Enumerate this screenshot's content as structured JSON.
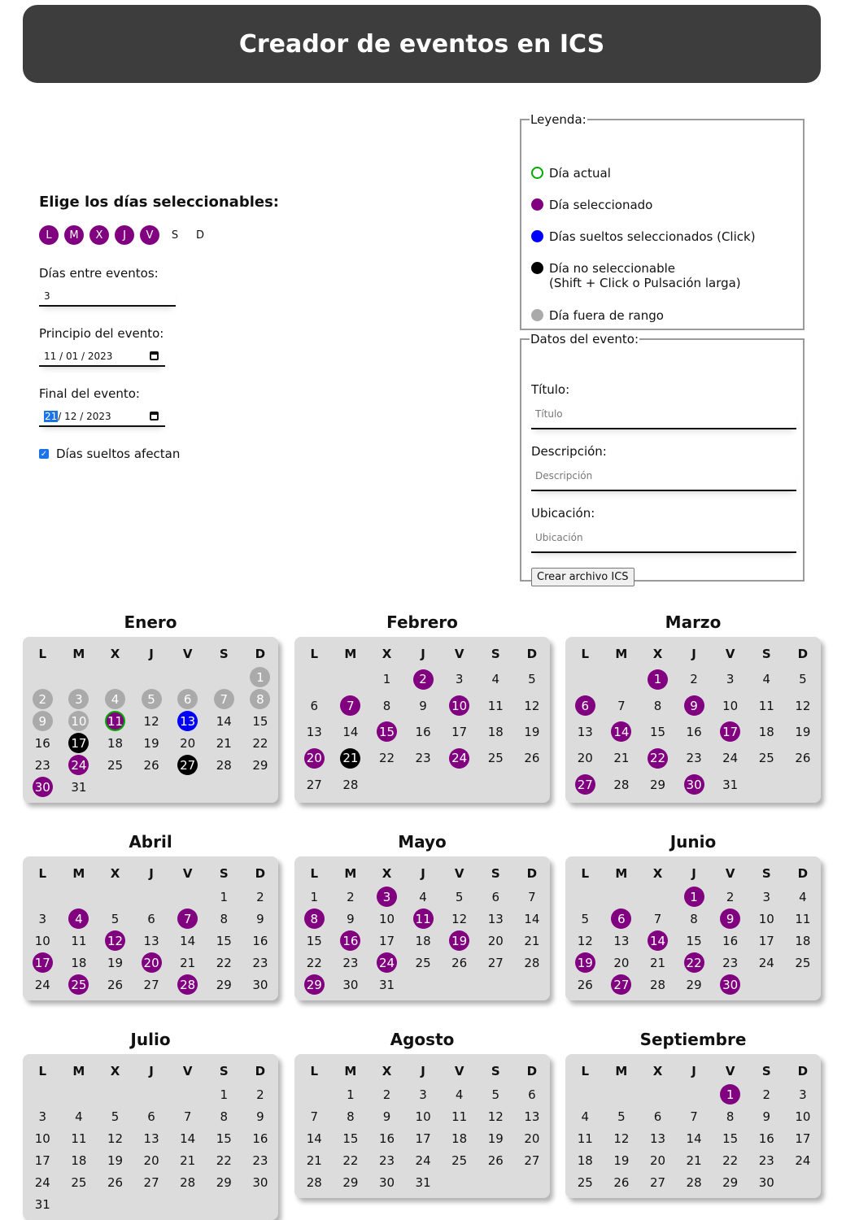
{
  "header": {
    "title": "Creador de eventos en ICS"
  },
  "settings": {
    "days_heading": "Elige los días seleccionables:",
    "weekdays": [
      {
        "label": "L",
        "on": true
      },
      {
        "label": "M",
        "on": true
      },
      {
        "label": "X",
        "on": true
      },
      {
        "label": "J",
        "on": true
      },
      {
        "label": "V",
        "on": true
      },
      {
        "label": "S",
        "on": false
      },
      {
        "label": "D",
        "on": false
      }
    ],
    "interval_label": "Días entre eventos:",
    "interval_value": "3",
    "start_label": "Principio del evento:",
    "start_value": "11 / 01 / 2023",
    "end_label": "Final del evento:",
    "end_value_day": "21",
    "end_value_rest": " / 12 / 2023",
    "loose_days_label": "Días sueltos afectan",
    "loose_days_checked": true
  },
  "legend": {
    "title": "Leyenda:",
    "items": [
      {
        "type": "cur",
        "text": "Día actual"
      },
      {
        "type": "sel",
        "text": "Día seleccionado"
      },
      {
        "type": "loose",
        "text": "Días sueltos seleccionados (Click)"
      },
      {
        "type": "nosel",
        "text": "Día no seleccionable",
        "text2": "(Shift + Click o Pulsación larga)"
      },
      {
        "type": "out",
        "text": "Día fuera de rango"
      }
    ]
  },
  "event": {
    "title": "Datos del evento:",
    "title_label": "Título:",
    "title_placeholder": "Título",
    "desc_label": "Descripción:",
    "desc_placeholder": "Descripción",
    "loc_label": "Ubicación:",
    "loc_placeholder": "Ubicación",
    "create_button": "Crear archivo ICS"
  },
  "calendar": {
    "weekday_headers": [
      "L",
      "M",
      "X",
      "J",
      "V",
      "S",
      "D"
    ],
    "months": [
      {
        "name": "Enero",
        "offset": 6,
        "days": 31,
        "sel": [
          24,
          30
        ],
        "out": [
          1,
          2,
          3,
          4,
          5,
          6,
          7,
          8,
          9,
          10
        ],
        "nosel": [
          17,
          27
        ],
        "loose": [
          13
        ],
        "cur": [
          11
        ],
        "selcur": [
          11
        ]
      },
      {
        "name": "Febrero",
        "offset": 2,
        "days": 28,
        "sel": [
          2,
          7,
          10,
          15,
          20,
          24
        ],
        "out": [],
        "nosel": [
          21
        ],
        "loose": [],
        "cur": [],
        "selcur": []
      },
      {
        "name": "Marzo",
        "offset": 2,
        "days": 31,
        "sel": [
          1,
          6,
          9,
          14,
          17,
          22,
          27,
          30
        ],
        "out": [],
        "nosel": [],
        "loose": [],
        "cur": [],
        "selcur": []
      },
      {
        "name": "Abril",
        "offset": 5,
        "days": 30,
        "sel": [
          4,
          7,
          12,
          17,
          20,
          25,
          28
        ],
        "out": [],
        "nosel": [],
        "loose": [],
        "cur": [],
        "selcur": []
      },
      {
        "name": "Mayo",
        "offset": 0,
        "days": 31,
        "sel": [
          3,
          8,
          11,
          16,
          19,
          24,
          29
        ],
        "out": [],
        "nosel": [],
        "loose": [],
        "cur": [],
        "selcur": []
      },
      {
        "name": "Junio",
        "offset": 3,
        "days": 30,
        "sel": [
          1,
          6,
          9,
          14,
          19,
          22,
          27,
          30
        ],
        "out": [],
        "nosel": [],
        "loose": [],
        "cur": [],
        "selcur": []
      },
      {
        "name": "Julio",
        "offset": 5,
        "days": 31,
        "sel": [],
        "out": [],
        "nosel": [],
        "loose": [],
        "cur": [],
        "selcur": []
      },
      {
        "name": "Agosto",
        "offset": 1,
        "days": 31,
        "sel": [],
        "out": [],
        "nosel": [],
        "loose": [],
        "cur": [],
        "selcur": []
      },
      {
        "name": "Septiembre",
        "offset": 4,
        "days": 30,
        "sel": [
          1
        ],
        "out": [],
        "nosel": [],
        "loose": [],
        "cur": [],
        "selcur": []
      }
    ]
  },
  "colors": {
    "selected": "#800080",
    "loose": "#0000ff",
    "current": "#00aa00",
    "disabled": "#000000",
    "out_of_range": "#aaaaaa",
    "header_bg": "#3d3d3d",
    "card_bg": "#dcdcdc"
  }
}
